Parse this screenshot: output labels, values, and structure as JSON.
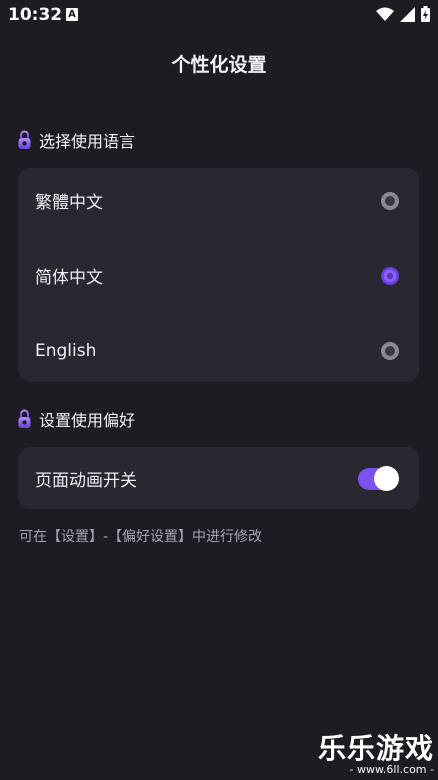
{
  "status_bar": {
    "time": "10:32",
    "notification_glyph": "A",
    "icons": [
      "wifi-icon",
      "signal-icon",
      "battery-charging-icon"
    ]
  },
  "page": {
    "title": "个性化设置"
  },
  "language_section": {
    "heading": "选择使用语言",
    "icon": "lock-icon",
    "options": [
      {
        "label": "繁體中文",
        "selected": false
      },
      {
        "label": "简体中文",
        "selected": true
      },
      {
        "label": "English",
        "selected": false
      }
    ]
  },
  "preference_section": {
    "heading": "设置使用偏好",
    "icon": "lock-icon",
    "toggle_label": "页面动画开关",
    "toggle_on": true
  },
  "hint": "可在【设置】-【偏好设置】中进行修改",
  "watermark": {
    "main": "乐乐游戏",
    "sub": "- www.6ll.com -"
  },
  "colors": {
    "background": "#1e1c23",
    "card": "#29272f",
    "accent": "#7b51ef"
  }
}
